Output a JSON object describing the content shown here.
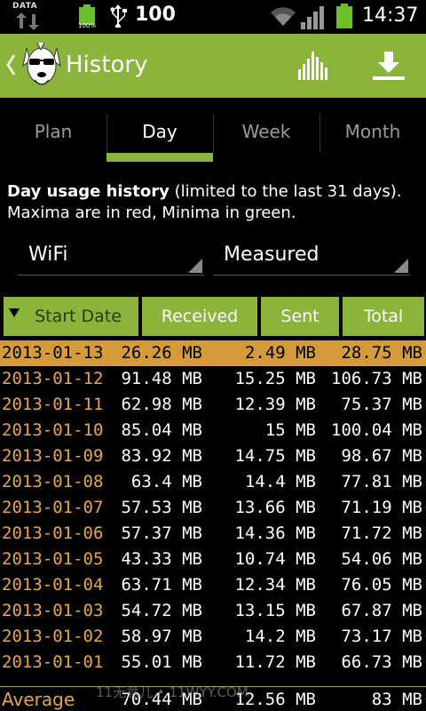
{
  "status_bar": {
    "data_label": "DATA",
    "battery_percent": "100%",
    "battery_value": "100",
    "time": "14:37"
  },
  "header": {
    "title": "History",
    "icons": [
      "chevron-left-icon",
      "dog-logo",
      "bar-chart-icon",
      "download-icon"
    ],
    "color": "#8ab43a"
  },
  "tabs": [
    {
      "label": "Plan",
      "active": false
    },
    {
      "label": "Day",
      "active": true
    },
    {
      "label": "Week",
      "active": false
    },
    {
      "label": "Month",
      "active": false
    }
  ],
  "description": {
    "bold": "Day usage history",
    "rest": " (limited to the last 31 days).",
    "line2": "Maxima are in red, Minima in green."
  },
  "filters": {
    "network": "WiFi",
    "mode": "Measured"
  },
  "table": {
    "columns": [
      "Start Date",
      "Received",
      "Sent",
      "Total"
    ],
    "rows": [
      {
        "date": "2013-01-13",
        "received": "26.26 MB",
        "sent": "2.49 MB",
        "total": "28.75 MB"
      },
      {
        "date": "2013-01-12",
        "received": "91.48 MB",
        "sent": "15.25 MB",
        "total": "106.73 MB"
      },
      {
        "date": "2013-01-11",
        "received": "62.98 MB",
        "sent": "12.39 MB",
        "total": "75.37 MB"
      },
      {
        "date": "2013-01-10",
        "received": "85.04 MB",
        "sent": "15 MB",
        "total": "100.04 MB"
      },
      {
        "date": "2013-01-09",
        "received": "83.92 MB",
        "sent": "14.75 MB",
        "total": "98.67 MB"
      },
      {
        "date": "2013-01-08",
        "received": "63.4 MB",
        "sent": "14.4 MB",
        "total": "77.81 MB"
      },
      {
        "date": "2013-01-07",
        "received": "57.53 MB",
        "sent": "13.66 MB",
        "total": "71.19 MB"
      },
      {
        "date": "2013-01-06",
        "received": "57.37 MB",
        "sent": "14.36 MB",
        "total": "71.72 MB"
      },
      {
        "date": "2013-01-05",
        "received": "43.33 MB",
        "sent": "10.74 MB",
        "total": "54.06 MB"
      },
      {
        "date": "2013-01-04",
        "received": "63.71 MB",
        "sent": "12.34 MB",
        "total": "76.05 MB"
      },
      {
        "date": "2013-01-03",
        "received": "54.72 MB",
        "sent": "13.15 MB",
        "total": "67.87 MB"
      },
      {
        "date": "2013-01-02",
        "received": "58.97 MB",
        "sent": "14.2 MB",
        "total": "73.17 MB"
      },
      {
        "date": "2013-01-01",
        "received": "55.01 MB",
        "sent": "11.72 MB",
        "total": "66.73 MB"
      }
    ],
    "average": {
      "label": "Average",
      "received": "70.44 MB",
      "sent": "12.56 MB",
      "total": "83 MB"
    }
  },
  "watermark": "11无意儿 • 11WYY.COM",
  "colors": {
    "accent": "#8ab43a",
    "date_text": "#e7a54a",
    "selected_row": "#d59a3a"
  }
}
